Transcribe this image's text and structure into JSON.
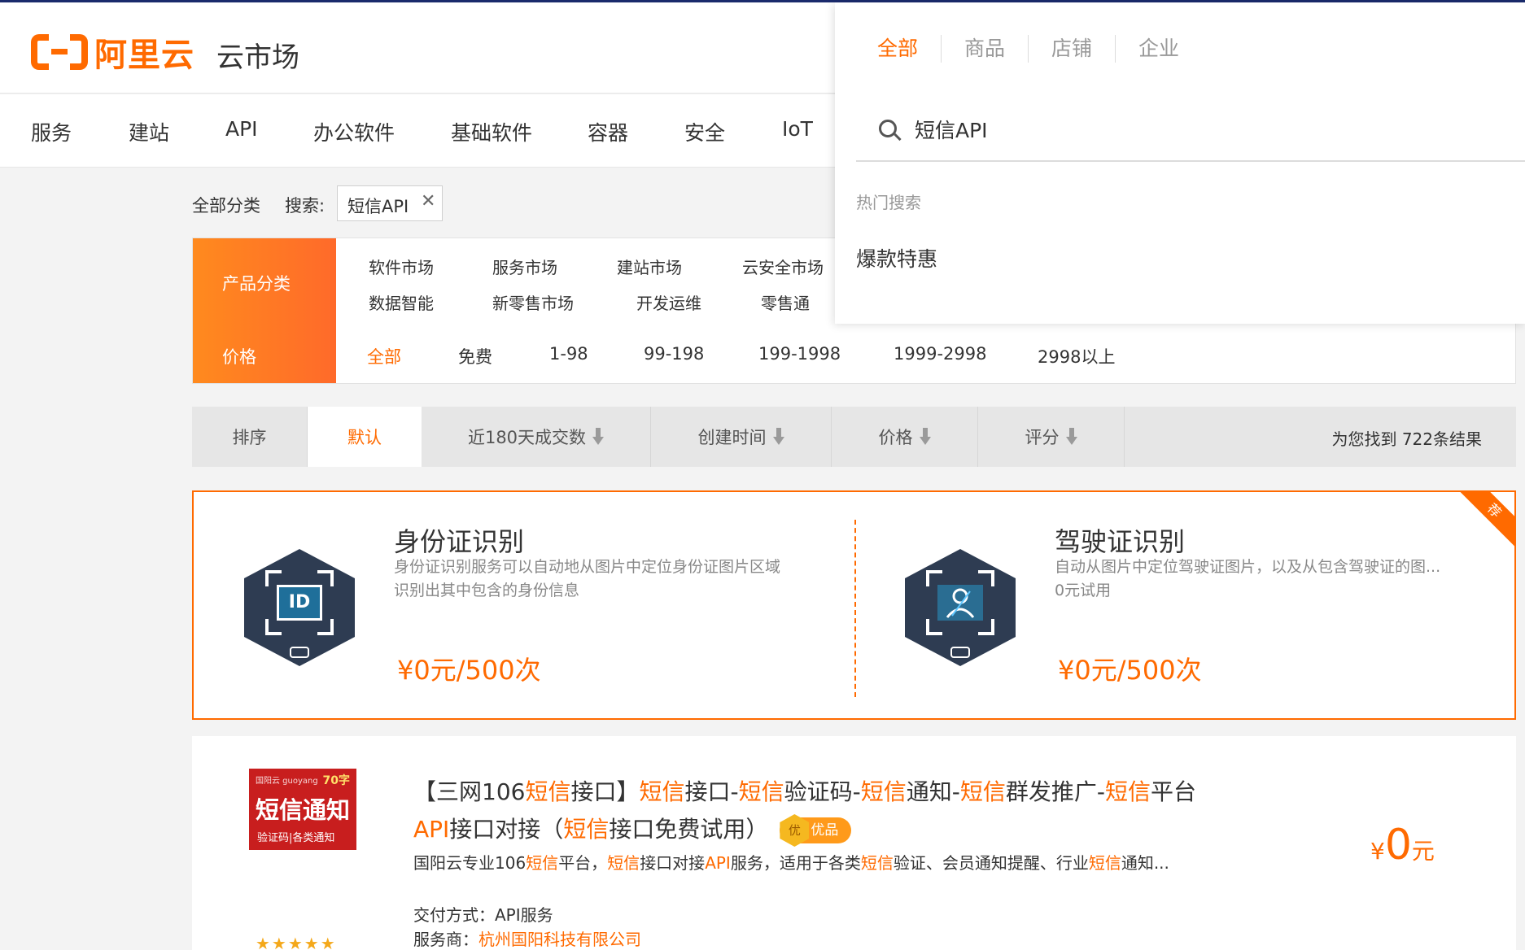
{
  "header": {
    "logo_text": "阿里云",
    "title": "云市场"
  },
  "nav": [
    "服务",
    "建站",
    "API",
    "办公软件",
    "基础软件",
    "容器",
    "安全",
    "IoT"
  ],
  "breadcrumb": {
    "all_categories": "全部分类",
    "search_label": "搜索:",
    "search_tag": "短信API",
    "remove_icon": "✕"
  },
  "filters": {
    "category_label": "产品分类",
    "categories_row1": [
      "软件市场",
      "服务市场",
      "建站市场",
      "云安全市场"
    ],
    "categories_row2": [
      "数据智能",
      "新零售市场",
      "开发运维",
      "零售通"
    ],
    "price_label": "价格",
    "price_options": [
      "全部",
      "免费",
      "1-98",
      "99-198",
      "199-1998",
      "1999-2998",
      "2998以上"
    ],
    "price_selected": "全部"
  },
  "sort": {
    "label": "排序",
    "options": [
      "默认",
      "近180天成交数",
      "创建时间",
      "价格",
      "评分"
    ],
    "active": "默认",
    "result_text": "为您找到 722条结果"
  },
  "promo": {
    "corner_label": "荐",
    "items": [
      {
        "title": "身份证识别",
        "desc_line1": "身份证识别服务可以自动地从图片中定位身份证图片区域",
        "desc_line2": "识别出其中包含的身份信息",
        "price": "¥0元/500次",
        "icon_label": "ID"
      },
      {
        "title": "驾驶证识别",
        "desc_line1": "自动从图片中定位驾驶证图片，以及从包含驾驶证的图...",
        "desc_line2": "0元试用",
        "price": "¥0元/500次",
        "icon_label": ""
      }
    ]
  },
  "product": {
    "thumb_top": "国阳云 guoyang",
    "thumb_badge": "70字",
    "thumb_main": "短信通知",
    "thumb_sub": "验证码|各类通知",
    "title_parts": [
      {
        "t": "【三网106",
        "h": false
      },
      {
        "t": "短信",
        "h": true
      },
      {
        "t": "接口】",
        "h": false
      },
      {
        "t": "短信",
        "h": true
      },
      {
        "t": "接口-",
        "h": false
      },
      {
        "t": "短信",
        "h": true
      },
      {
        "t": "验证码-",
        "h": false
      },
      {
        "t": "短信",
        "h": true
      },
      {
        "t": "通知-",
        "h": false
      },
      {
        "t": "短信",
        "h": true
      },
      {
        "t": "群发推广-",
        "h": false
      },
      {
        "t": "短信",
        "h": true
      },
      {
        "t": "平台",
        "h": false
      },
      {
        "t": "API",
        "h": true
      },
      {
        "t": "接口对接（",
        "h": false
      },
      {
        "t": "短信",
        "h": true
      },
      {
        "t": "接口免费试用）",
        "h": false
      }
    ],
    "badge": "优品",
    "badge_icon": "优",
    "desc_parts": [
      {
        "t": "国阳云专业106",
        "h": false
      },
      {
        "t": "短信",
        "h": true
      },
      {
        "t": "平台，",
        "h": false
      },
      {
        "t": "短信",
        "h": true
      },
      {
        "t": "接口对接",
        "h": false
      },
      {
        "t": "API",
        "h": true
      },
      {
        "t": "服务，适用于各类",
        "h": false
      },
      {
        "t": "短信",
        "h": true
      },
      {
        "t": "验证、会员通知提醒、行业",
        "h": false
      },
      {
        "t": "短信",
        "h": true
      },
      {
        "t": "通知...",
        "h": false
      }
    ],
    "delivery_label": "交付方式：",
    "delivery_value": "API服务",
    "vendor_label": "服务商：",
    "vendor_value": "杭州国阳科技有限公司",
    "price_currency": "¥",
    "price_value": "0",
    "price_unit": "元",
    "stars": "★★★★★"
  },
  "dropdown": {
    "tabs": [
      "全部",
      "商品",
      "店铺",
      "企业"
    ],
    "active_tab": "全部",
    "search_value": "短信API",
    "hot_label": "热门搜索",
    "hot_items": [
      "爆款特惠"
    ]
  },
  "colors": {
    "accent": "#ff6a00",
    "promo_border": "#ff6a00"
  }
}
